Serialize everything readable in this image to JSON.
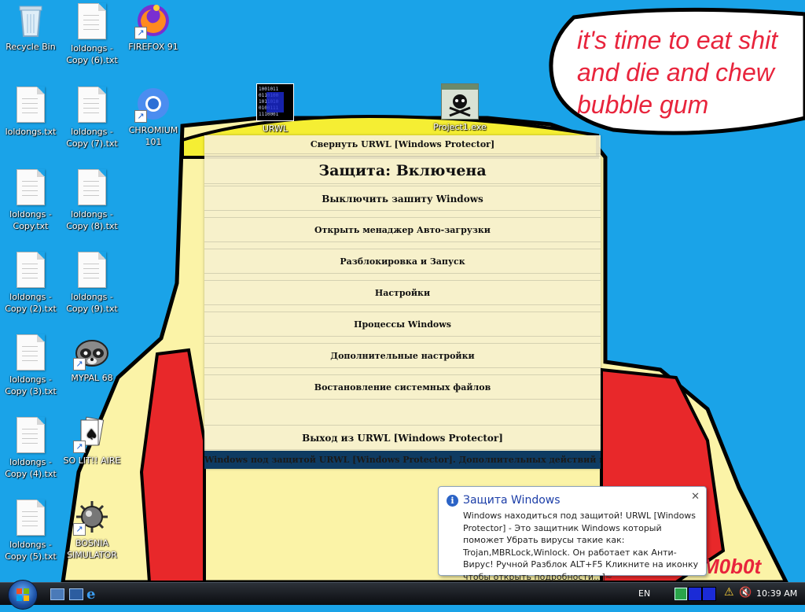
{
  "desktop": {
    "icons": [
      {
        "label": "Recycle Bin"
      },
      {
        "label": "loldongs - Copy (6).txt"
      },
      {
        "label": "FIREFOX 91"
      },
      {
        "label": "loldongs.txt"
      },
      {
        "label": "loldongs - Copy (7).txt"
      },
      {
        "label": "CHROMIUM 101"
      },
      {
        "label": "loldongs - Copy.txt"
      },
      {
        "label": "loldongs - Copy (8).txt"
      },
      {
        "label": "loldongs - Copy (2).txt"
      },
      {
        "label": "loldongs - Copy (9).txt"
      },
      {
        "label": "loldongs - Copy (3).txt"
      },
      {
        "label": "MYPAL 68"
      },
      {
        "label": "loldongs - Copy (4).txt"
      },
      {
        "label": "SO LIT!! AIRE"
      },
      {
        "label": "loldongs - Copy (5).txt"
      },
      {
        "label": "BOSNIA SIMULATOR"
      },
      {
        "label": "URWL"
      },
      {
        "label": "Project1.exe"
      }
    ]
  },
  "wallpaper": {
    "speech_text": [
      "it's time to eat shit",
      "and die and chew",
      "bubble gum"
    ],
    "signature": "M0b0t",
    "colors": {
      "sky": "#1aa3e8",
      "skin": "#fbf3a7",
      "shirt": "#e8282a",
      "text": "#e8243c"
    }
  },
  "urwl": {
    "collapse": "Свернуть URWL [Windows Protector]",
    "status": "Защита: Включена",
    "disable": "Выключить зашиту Windows",
    "autoload": "Открыть менаджер Авто-загрузки",
    "unlock": "Разблокировка и Запуск",
    "settings": "Настройки",
    "processes": "Процессы Windows",
    "advanced": "Дополнительные настройки",
    "restore": "Востановление системных файлов",
    "exit": "Выход из URWL [Windows Protector]",
    "footer": "Windows под защитой URWL [Windows Protector]. Дополнительных действий не требуется."
  },
  "balloon": {
    "title": "Защита Windows",
    "body": "Windows находиться под защитой! URWL [Windows Protector] - Это защитник Windows который поможет Убрать вирусы такие как: Trojan,MBRLock,Winlock. Он работает как Анти-Вирус! Ручной Разблок ALT+F5 Кликните на иконку чтобы открыть подробности...]~"
  },
  "taskbar": {
    "language": "EN",
    "time": "10:39 AM"
  }
}
